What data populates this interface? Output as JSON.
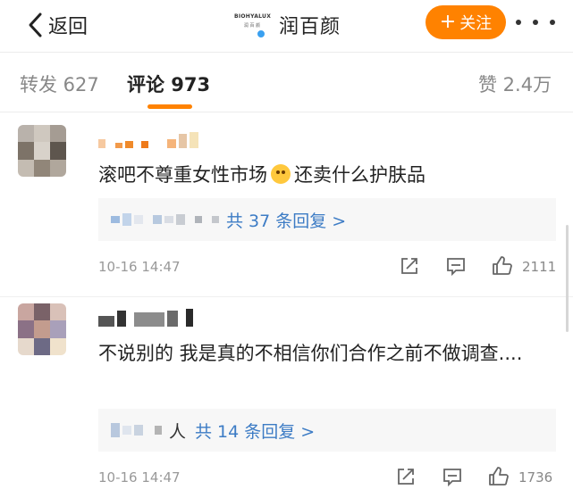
{
  "nav": {
    "back_label": "返回",
    "account_name": "润百颜",
    "logo_line1": "BIOHYALUX",
    "logo_line2": "润 百 颜",
    "follow_label": "关注"
  },
  "tabs": {
    "repost": "转发 627",
    "comment": "评论 973",
    "like": "赞 2.4万",
    "active": "comment"
  },
  "colors": {
    "accent": "#ff8200",
    "link": "#3d7cc5",
    "verified": "#3aa0f0"
  },
  "comments": [
    {
      "text": "滚吧不尊重女性市场",
      "emoji": "fearful-face",
      "text_after": "还卖什么护肤品",
      "replies_label": "共 37 条回复 >",
      "time": "10-16 14:47",
      "likes": "2111"
    },
    {
      "text": "不说别的 我是真的不相信你们合作之前不做调查....",
      "reply_person": "人",
      "replies_label": "共 14 条回复 >",
      "time": "10-16 14:47",
      "likes": "1736"
    }
  ]
}
